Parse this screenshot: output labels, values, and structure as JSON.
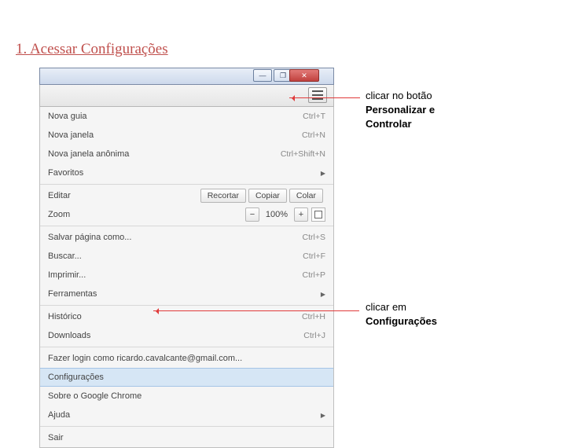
{
  "heading": "1. Acessar Configurações",
  "menu": {
    "new_tab": "Nova guia",
    "sc_new_tab": "Ctrl+T",
    "new_window": "Nova janela",
    "sc_new_window": "Ctrl+N",
    "incognito": "Nova janela anônima",
    "sc_incognito": "Ctrl+Shift+N",
    "bookmarks": "Favoritos",
    "edit": "Editar",
    "cut": "Recortar",
    "copy": "Copiar",
    "paste": "Colar",
    "zoom": "Zoom",
    "zoom_minus": "−",
    "zoom_value": "100%",
    "zoom_plus": "+",
    "save_as": "Salvar página como...",
    "sc_save": "Ctrl+S",
    "find": "Buscar...",
    "sc_find": "Ctrl+F",
    "print": "Imprimir...",
    "sc_print": "Ctrl+P",
    "tools": "Ferramentas",
    "history": "Histórico",
    "sc_history": "Ctrl+H",
    "downloads": "Downloads",
    "sc_downloads": "Ctrl+J",
    "login": "Fazer login como ricardo.cavalcante@gmail.com...",
    "settings": "Configurações",
    "about": "Sobre o Google Chrome",
    "help": "Ajuda",
    "exit": "Sair"
  },
  "annot1_l1": "clicar no botão",
  "annot1_l2": "Personalizar e",
  "annot1_l3": "Controlar",
  "annot2_l1": "clicar em",
  "annot2_l2": "Configurações"
}
